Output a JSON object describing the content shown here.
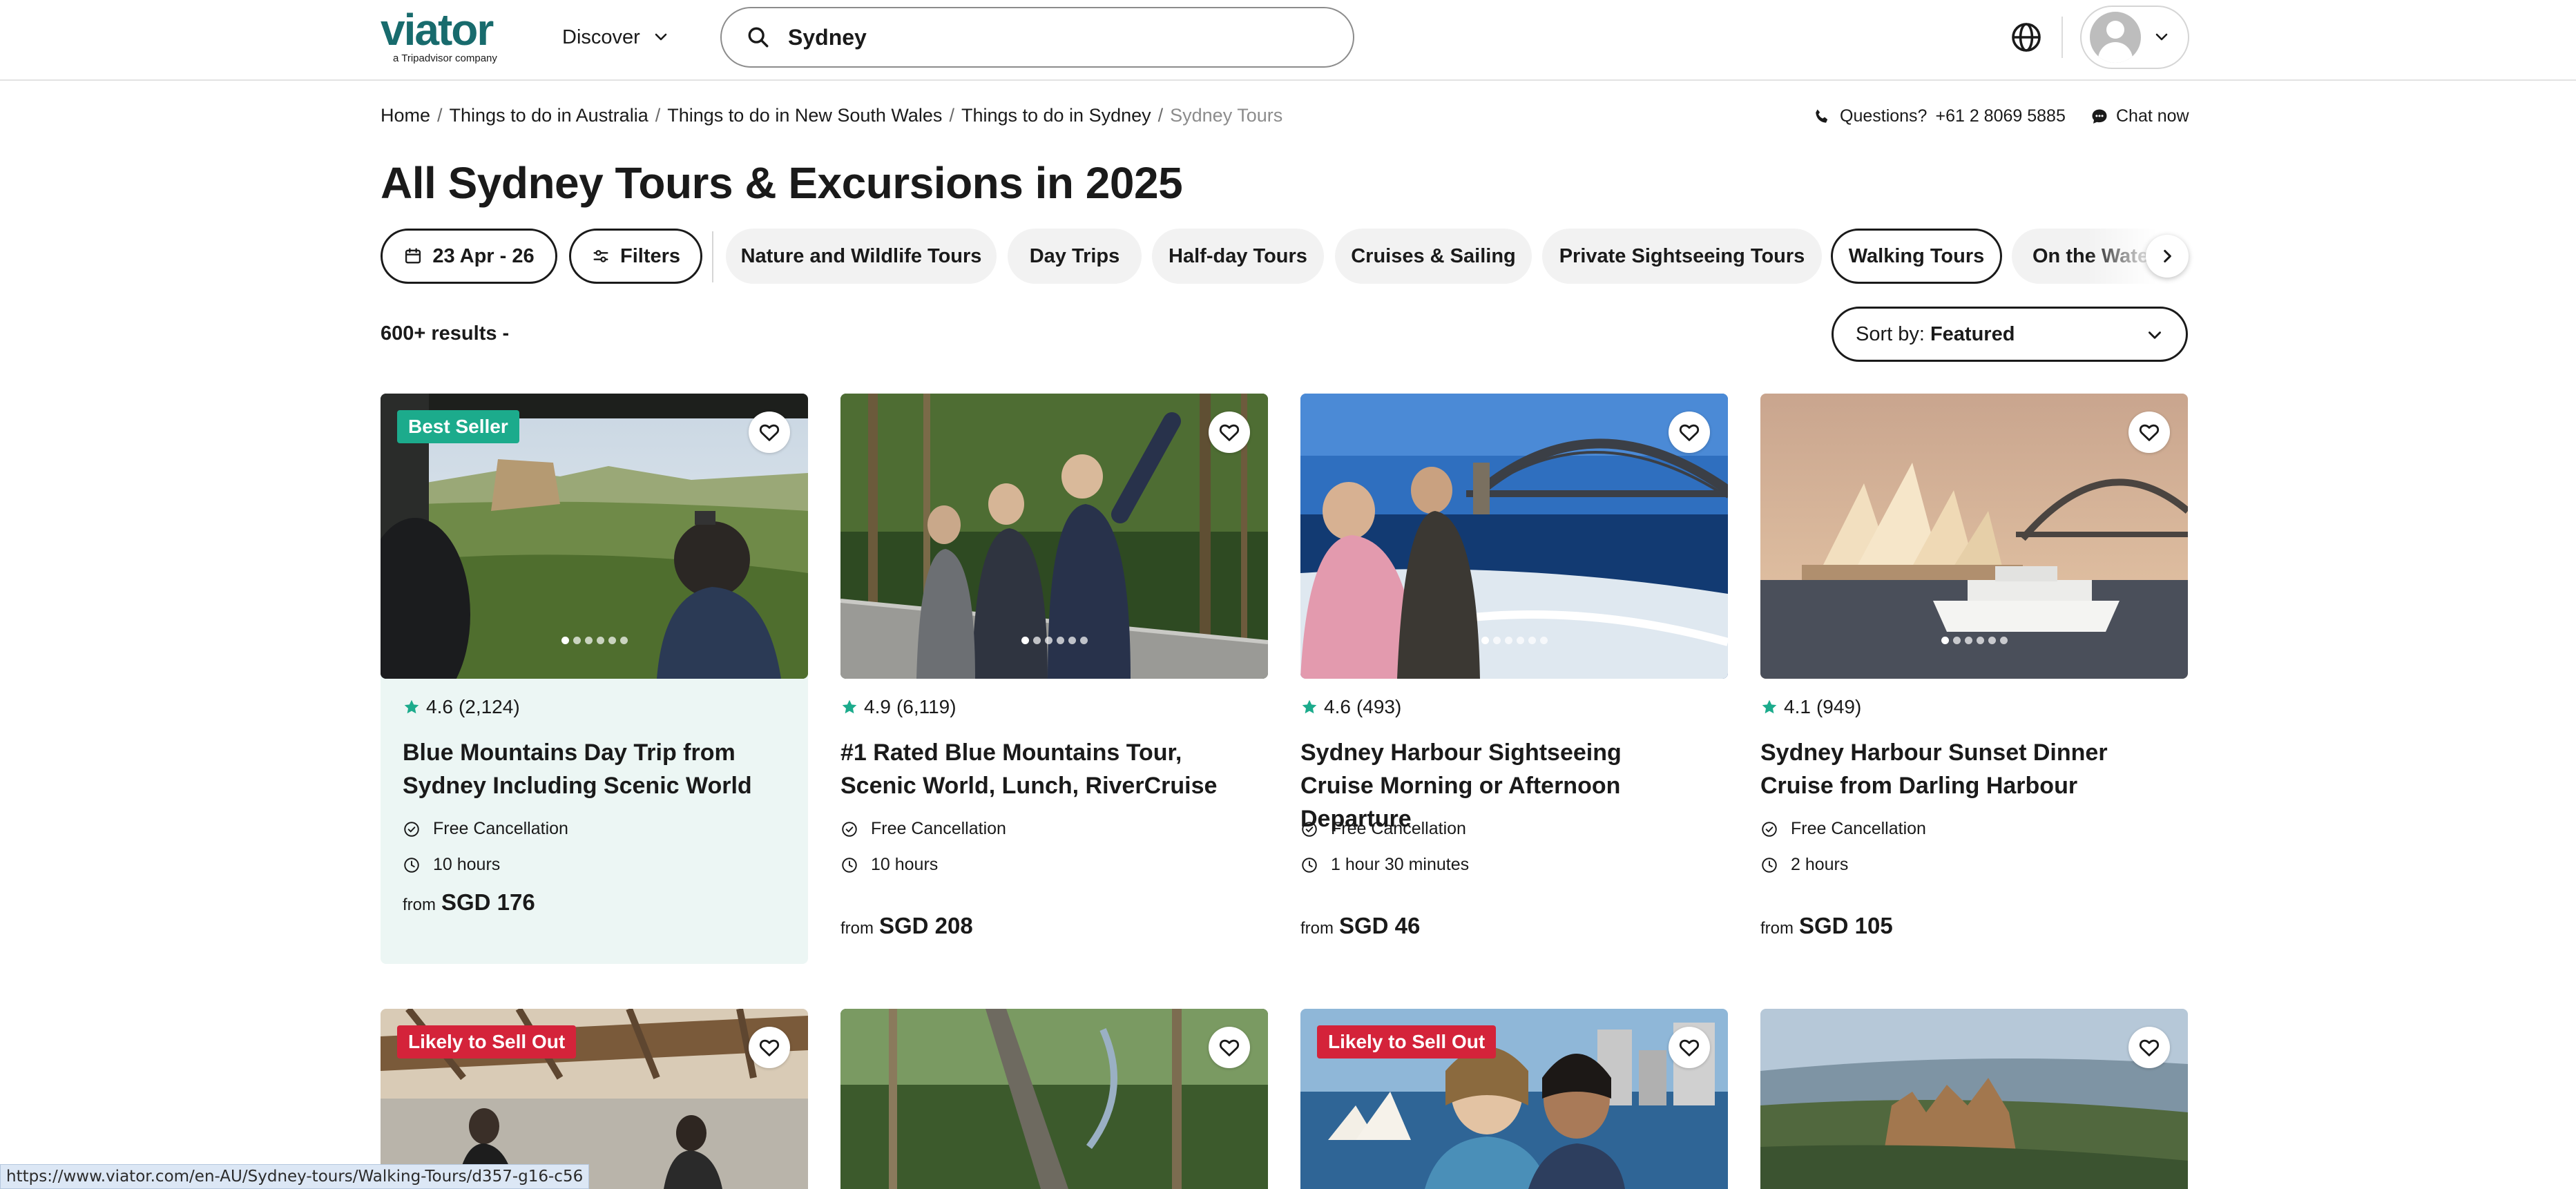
{
  "header": {
    "logo_text": "viator",
    "logo_sub": "a Tripadvisor company",
    "discover_label": "Discover",
    "search_value": "Sydney",
    "search_icon": "search-icon",
    "globe_icon": "globe-icon"
  },
  "breadcrumb": {
    "items": [
      "Home",
      "Things to do in Australia",
      "Things to do in New South Wales",
      "Things to do in Sydney",
      "Sydney Tours"
    ]
  },
  "help": {
    "questions_label": "Questions?",
    "phone": "+61 2 8069 5885",
    "chat_label": "Chat now"
  },
  "page": {
    "title": "All Sydney Tours & Excursions in 2025",
    "results": "600+ results -"
  },
  "filters": {
    "date_label": "23 Apr - 26",
    "filters_label": "Filters",
    "chips": [
      "Nature and Wildlife Tours",
      "Day Trips",
      "Half-day Tours",
      "Cruises & Sailing",
      "Private Sightseeing Tours",
      "Walking Tours",
      "On the Water"
    ]
  },
  "sort": {
    "label": "Sort by:",
    "value": "Featured"
  },
  "colors": {
    "brand": "#186b6d",
    "accent_green": "#1cab8c",
    "badge_red": "#d4233a",
    "highlight_bg": "#ecf6f4"
  },
  "cards": [
    {
      "badge": "Best Seller",
      "rating": "4.6",
      "reviews": "(2,124)",
      "title": "Blue Mountains Day Trip from Sydney Including Scenic World",
      "cancellation": "Free Cancellation",
      "duration": "10 hours",
      "price_prefix": "from",
      "price": "SGD 176"
    },
    {
      "rating": "4.9",
      "reviews": "(6,119)",
      "title": "#1 Rated Blue Mountains Tour, Scenic World, Lunch, RiverCruise",
      "cancellation": "Free Cancellation",
      "duration": "10 hours",
      "price_prefix": "from",
      "price": "SGD 208"
    },
    {
      "rating": "4.6",
      "reviews": "(493)",
      "title": "Sydney Harbour Sightseeing Cruise Morning or Afternoon Departure",
      "cancellation": "Free Cancellation",
      "duration": "1 hour 30 minutes",
      "price_prefix": "from",
      "price": "SGD 46"
    },
    {
      "rating": "4.1",
      "reviews": "(949)",
      "title": "Sydney Harbour Sunset Dinner Cruise from Darling Harbour",
      "cancellation": "Free Cancellation",
      "duration": "2 hours",
      "price_prefix": "from",
      "price": "SGD 105"
    }
  ],
  "second_row_badges": [
    "Likely to Sell Out",
    "Likely to Sell Out"
  ],
  "statusbar": {
    "url": "https://www.viator.com/en-AU/Sydney-tours/Walking-Tours/d357-g16-c56"
  }
}
